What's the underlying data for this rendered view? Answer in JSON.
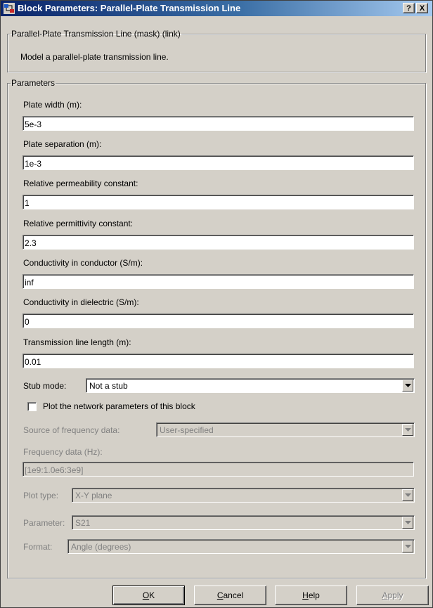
{
  "window": {
    "title": "Block Parameters: Parallel-Plate Transmission Line",
    "help_button": "?",
    "close_button": "X",
    "icon": "simulink-block-icon"
  },
  "description_group": {
    "legend": "Parallel-Plate Transmission Line (mask) (link)",
    "text": "Model a parallel-plate transmission line."
  },
  "parameters": {
    "legend": "Parameters",
    "plate_width": {
      "label": "Plate width (m):",
      "value": "5e-3"
    },
    "plate_separation": {
      "label": "Plate separation (m):",
      "value": "1e-3"
    },
    "relative_permeability": {
      "label": "Relative permeability constant:",
      "value": "1"
    },
    "relative_permittivity": {
      "label": "Relative permittivity constant:",
      "value": "2.3"
    },
    "conductivity_conductor": {
      "label": "Conductivity in conductor (S/m):",
      "value": "inf"
    },
    "conductivity_dielectric": {
      "label": "Conductivity in dielectric (S/m):",
      "value": "0"
    },
    "line_length": {
      "label": "Transmission line length (m):",
      "value": "0.01"
    },
    "stub_mode": {
      "label": "Stub mode:",
      "value": "Not a stub"
    },
    "plot_checkbox": {
      "label": "Plot the network parameters of this block",
      "checked": false
    },
    "frequency_source": {
      "label": "Source of frequency data:",
      "value": "User-specified"
    },
    "frequency_data": {
      "label": "Frequency data (Hz):",
      "value": "[1e9:1.0e6:3e9]"
    },
    "plot_type": {
      "label": "Plot type:",
      "value": "X-Y plane"
    },
    "parameter": {
      "label": "Parameter:",
      "value": "S21"
    },
    "format": {
      "label": "Format:",
      "value": "Angle (degrees)"
    }
  },
  "buttons": {
    "ok": {
      "mnemonic": "O",
      "rest": "K"
    },
    "cancel": {
      "mnemonic": "C",
      "rest": "ancel"
    },
    "help": {
      "mnemonic": "H",
      "rest": "elp"
    },
    "apply": {
      "mnemonic": "A",
      "rest": "pply",
      "enabled": false
    }
  },
  "colors": {
    "titlebar_start": "#0a246a",
    "titlebar_end": "#a6caf0",
    "dialog_face": "#d4d0c8",
    "disabled_text": "#808080"
  }
}
